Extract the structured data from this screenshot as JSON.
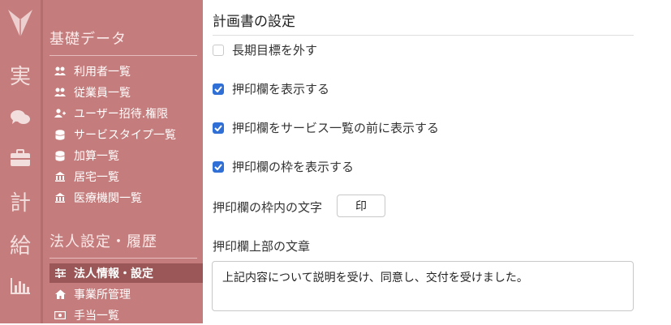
{
  "rail": {
    "items": [
      {
        "label": "実"
      },
      {
        "label": "計"
      },
      {
        "label": "給"
      }
    ],
    "icons": [
      "logo-icon",
      "chat-icon",
      "briefcase-icon",
      "bar-chart-icon"
    ]
  },
  "sidebar": {
    "section1": {
      "title": "基礎データ",
      "items": [
        {
          "label": "利用者一覧",
          "icon": "users-icon"
        },
        {
          "label": "従業員一覧",
          "icon": "users-icon"
        },
        {
          "label": "ユーザー招待.権限",
          "icon": "user-plus-icon"
        },
        {
          "label": "サービスタイプ一覧",
          "icon": "database-icon"
        },
        {
          "label": "加算一覧",
          "icon": "database-icon"
        },
        {
          "label": "居宅一覧",
          "icon": "building-icon"
        },
        {
          "label": "医療機関一覧",
          "icon": "building-icon"
        }
      ]
    },
    "section2": {
      "title": "法人設定・履歴",
      "items": [
        {
          "label": "法人情報・設定",
          "icon": "sliders-icon",
          "active": true
        },
        {
          "label": "事業所管理",
          "icon": "home-icon"
        },
        {
          "label": "手当一覧",
          "icon": "money-icon"
        }
      ]
    }
  },
  "main": {
    "title": "計画書の設定",
    "options": [
      {
        "label": "長期目標を外す",
        "checked": false
      },
      {
        "label": "押印欄を表示する",
        "checked": true
      },
      {
        "label": "押印欄をサービス一覧の前に表示する",
        "checked": true
      },
      {
        "label": "押印欄の枠を表示する",
        "checked": true
      }
    ],
    "stamp_label": "押印欄の枠内の文字",
    "stamp_value": "印",
    "text_label": "押印欄上部の文章",
    "text_value": "上記内容について説明を受け、同意し、交付を受けました。"
  },
  "colors": {
    "sidebar_bg": "#c57c7c",
    "active_bg": "#9b5757",
    "checkbox": "#2f6fd6"
  }
}
